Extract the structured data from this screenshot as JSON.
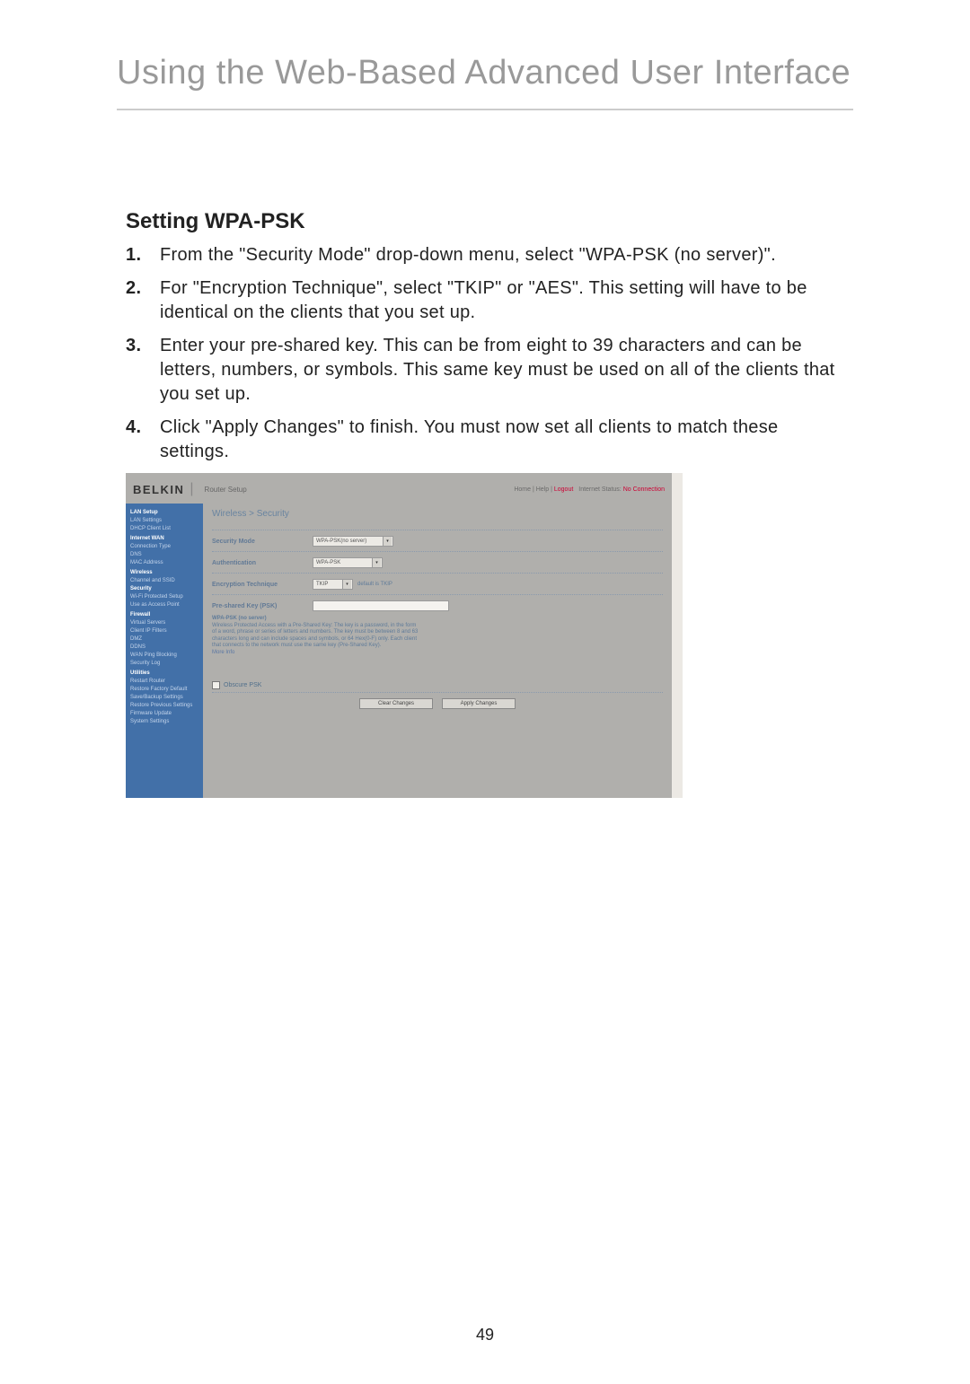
{
  "page_title": "Using the Web-Based Advanced User Interface",
  "section_heading": "Setting WPA-PSK",
  "steps": [
    "From the \"Security Mode\" drop-down menu, select \"WPA-PSK (no server)\".",
    "For \"Encryption Technique\", select \"TKIP\" or \"AES\". This setting will have to be identical on the clients that you set up.",
    "Enter your pre-shared key. This can be from eight to 39 characters and can be letters, numbers, or symbols. This same key must be used on all of the clients that you set up.",
    "Click \"Apply Changes\" to finish. You must now set all clients to match these settings."
  ],
  "screenshot": {
    "brand": "BELKIN",
    "router_setup": "Router Setup",
    "top_right": {
      "home": "Home",
      "help": "Help",
      "logout": "Logout",
      "status_label": "Internet Status:",
      "status_value": "No Connection"
    },
    "sidebar": {
      "groups": [
        {
          "heading": "LAN Setup",
          "items": [
            "LAN Settings",
            "DHCP Client List"
          ],
          "active": -1
        },
        {
          "heading": "Internet WAN",
          "items": [
            "Connection Type",
            "DNS",
            "MAC Address"
          ],
          "active": -1
        },
        {
          "heading": "Wireless",
          "items": [
            "Channel and SSID",
            "Security",
            "Wi-Fi Protected Setup",
            "Use as Access Point"
          ],
          "active": 1
        },
        {
          "heading": "Firewall",
          "items": [
            "Virtual Servers",
            "Client IP Filters",
            "DMZ",
            "DDNS",
            "WAN Ping Blocking",
            "Security Log"
          ],
          "active": -1
        },
        {
          "heading": "Utilities",
          "items": [
            "Restart Router",
            "Restore Factory Default",
            "Save/Backup Settings",
            "Restore Previous Settings",
            "Firmware Update",
            "System Settings"
          ],
          "active": -1
        }
      ]
    },
    "panel": {
      "title": "Wireless > Security",
      "rows": {
        "security_mode": {
          "label": "Security Mode",
          "value": "WPA-PSK(no server)"
        },
        "authentication": {
          "label": "Authentication",
          "value": "WPA-PSK"
        },
        "encryption": {
          "label": "Encryption Technique",
          "value": "TKIP",
          "helper": "default is TKIP"
        },
        "psk": {
          "label": "Pre-shared Key (PSK)"
        }
      },
      "desc": {
        "bold": "WPA-PSK (no server)",
        "text": "Wireless Protected Access with a Pre-Shared Key: The key is a password, in the form of a word, phrase or series of letters and numbers. The key must be between 8 and 63 characters long and can include spaces and symbols, or 64 Hex(0-F) only. Each client that connects to the network must use the same key (Pre-Shared Key).",
        "more": "More Info"
      },
      "obscure": "Obscure PSK",
      "buttons": {
        "clear": "Clear Changes",
        "apply": "Apply Changes"
      }
    }
  },
  "page_number": "49"
}
